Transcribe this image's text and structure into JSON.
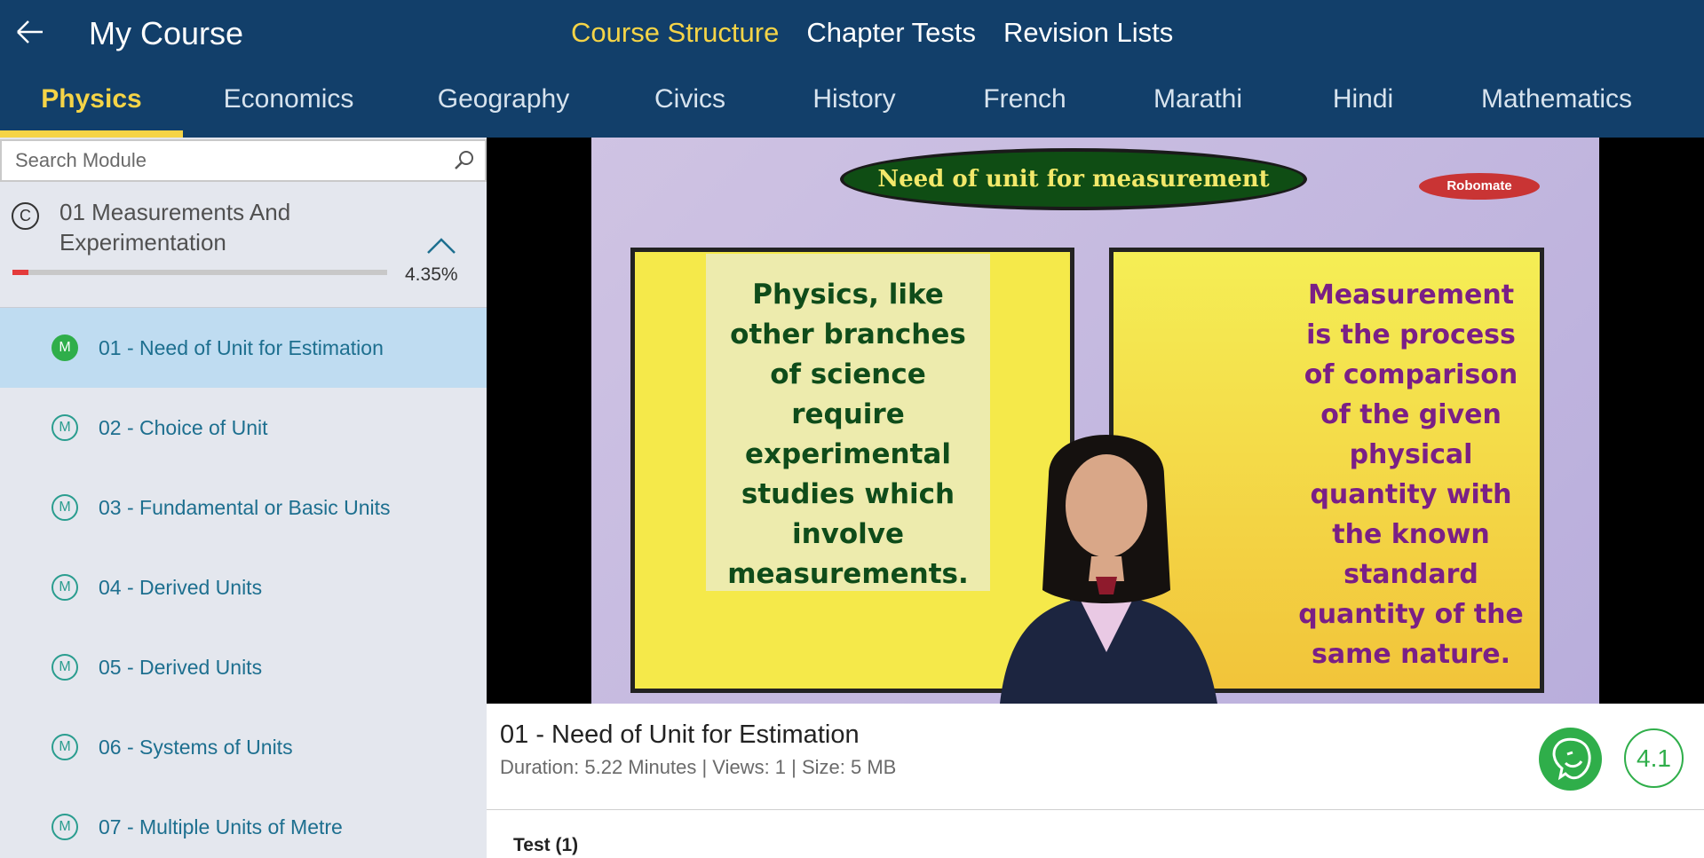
{
  "header": {
    "title": "My Course",
    "nav": [
      {
        "label": "Course Structure",
        "active": true
      },
      {
        "label": "Chapter Tests",
        "active": false
      },
      {
        "label": "Revision Lists",
        "active": false
      }
    ]
  },
  "subjects": [
    {
      "label": "Physics",
      "active": true
    },
    {
      "label": "Economics",
      "active": false
    },
    {
      "label": "Geography",
      "active": false
    },
    {
      "label": "Civics",
      "active": false
    },
    {
      "label": "History",
      "active": false
    },
    {
      "label": "French",
      "active": false
    },
    {
      "label": "Marathi",
      "active": false
    },
    {
      "label": "Hindi",
      "active": false
    },
    {
      "label": "Mathematics",
      "active": false
    }
  ],
  "sidebar": {
    "search_placeholder": "Search Module",
    "chapter": {
      "icon_letter": "C",
      "title": "01 Measurements And Experimentation",
      "progress_percent": 4.35,
      "progress_text": "4.35%"
    },
    "modules": [
      {
        "badge": "M",
        "label": "01 - Need of Unit for Estimation",
        "active": true
      },
      {
        "badge": "M",
        "label": "02 - Choice of Unit",
        "active": false
      },
      {
        "badge": "M",
        "label": "03 - Fundamental or Basic Units",
        "active": false
      },
      {
        "badge": "M",
        "label": "04 - Derived Units",
        "active": false
      },
      {
        "badge": "M",
        "label": "05 - Derived Units",
        "active": false
      },
      {
        "badge": "M",
        "label": "06 - Systems of Units",
        "active": false
      },
      {
        "badge": "M",
        "label": "07 - Multiple Units of Metre",
        "active": false
      }
    ]
  },
  "video": {
    "slide_title": "Need of unit for measurement",
    "slide_logo": "Robomate",
    "slide_left_text": "Physics, like other branches of science require experimental studies which involve measurements.",
    "slide_right_text": "Measurement is the process of comparison of the given physical quantity with the known standard quantity of the same nature.",
    "title": "01 - Need of Unit for Estimation",
    "meta": "Duration: 5.22 Minutes | Views: 1 | Size: 5 MB",
    "rating": "4.1"
  },
  "tests": {
    "label": "Test  (1)"
  },
  "colors": {
    "header_bg": "#123f6a",
    "accent": "#f5d447",
    "active_row": "#bfdcf1",
    "module_text": "#1d6f8f",
    "green": "#2fae4a",
    "progress": "#e43b3b"
  },
  "icons": {
    "back": "arrow-left-icon",
    "search": "search-icon",
    "collapse": "chevron-up-icon",
    "feedback": "smiley-face-icon"
  }
}
